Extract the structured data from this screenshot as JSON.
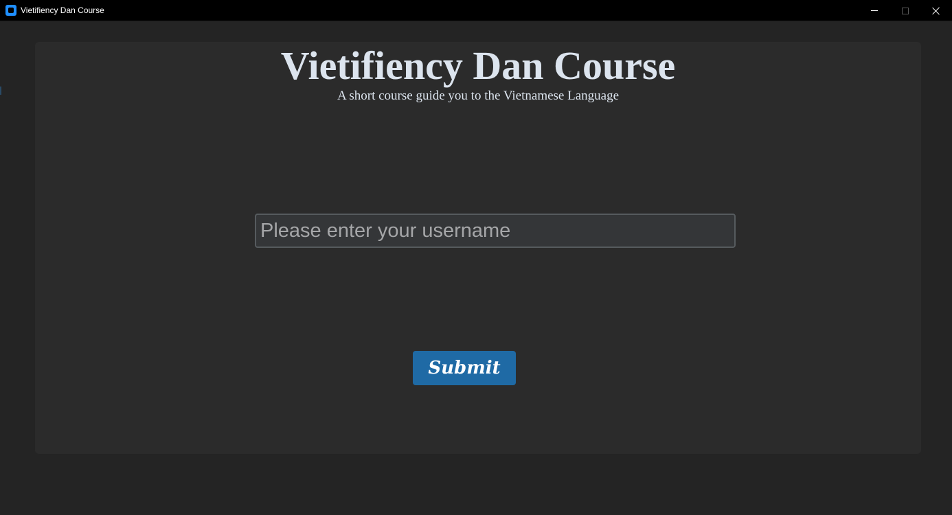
{
  "window": {
    "title": "Vietifiency Dan Course",
    "icon": "app-icon",
    "accent_color": "#1f8fff"
  },
  "main": {
    "heading": "Vietifiency Dan Course",
    "subheading": "A short course guide you to the Vietnamese Language",
    "username_input": {
      "value": "",
      "placeholder": "Please enter your username"
    },
    "submit_label": "Submit",
    "button_color": "#1f6aa5"
  }
}
